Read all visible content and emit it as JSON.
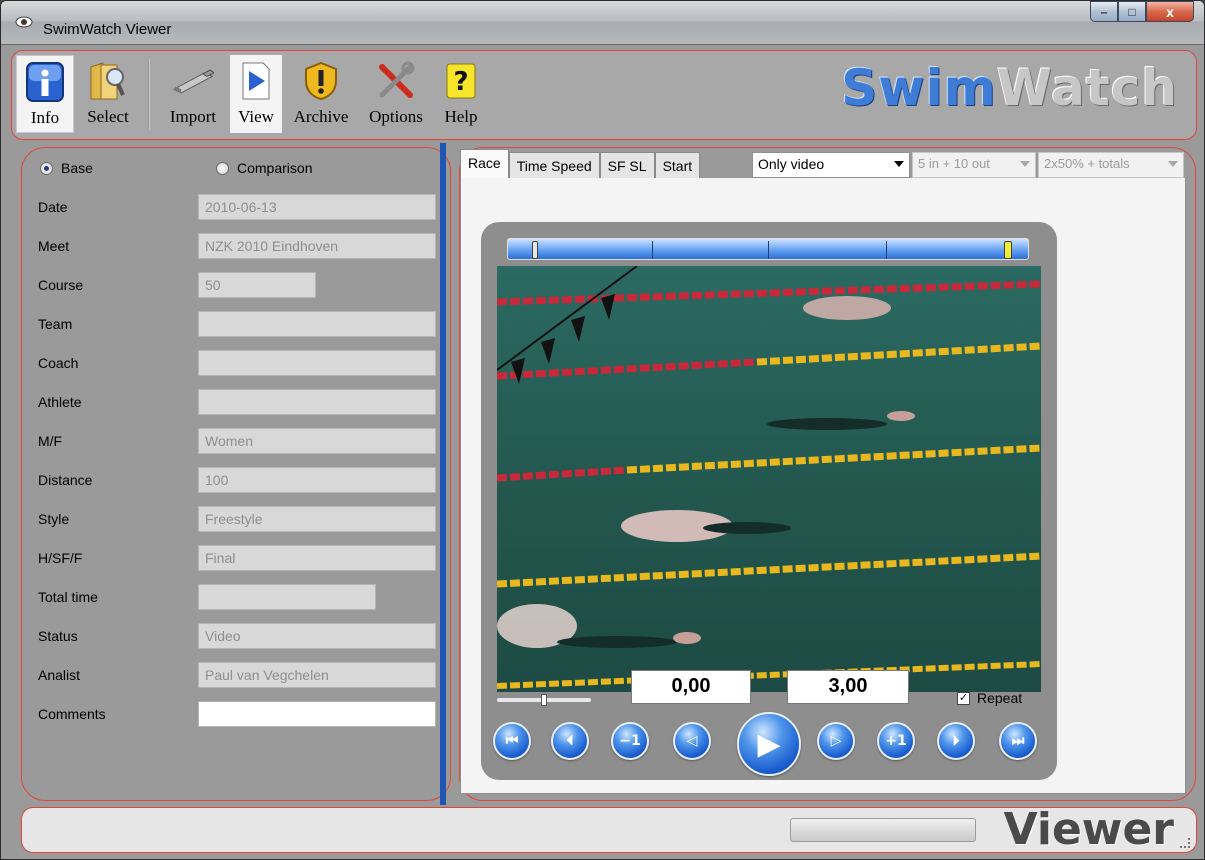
{
  "window": {
    "title": "SwimWatch Viewer",
    "min": "–",
    "max": "□",
    "close": "x"
  },
  "toolbar": {
    "items": [
      {
        "label": "Info"
      },
      {
        "label": "Select"
      },
      {
        "label": "Import"
      },
      {
        "label": "View"
      },
      {
        "label": "Archive"
      },
      {
        "label": "Options"
      },
      {
        "label": "Help"
      }
    ],
    "active": "Info",
    "logo_part1": "Swim",
    "logo_part2": "Watch"
  },
  "left": {
    "radio_base": "Base",
    "radio_comparison": "Comparison",
    "selected_radio": "Base",
    "fields": [
      {
        "label": "Date",
        "value": "2010-06-13"
      },
      {
        "label": "Meet",
        "value": "NZK 2010 Eindhoven"
      },
      {
        "label": "Course",
        "value": "50"
      },
      {
        "label": "Team",
        "value": ""
      },
      {
        "label": "Coach",
        "value": ""
      },
      {
        "label": "Athlete",
        "value": ""
      },
      {
        "label": "M/F",
        "value": "Women"
      },
      {
        "label": "Distance",
        "value": "100"
      },
      {
        "label": "Style",
        "value": "Freestyle"
      },
      {
        "label": "H/SF/F",
        "value": "Final"
      },
      {
        "label": "Total time",
        "value": ""
      },
      {
        "label": "Status",
        "value": "Video"
      },
      {
        "label": "Analist",
        "value": "Paul van Vegchelen"
      },
      {
        "label": "Comments",
        "value": ""
      }
    ]
  },
  "right": {
    "tabs": [
      {
        "label": "Race"
      },
      {
        "label": "Time Speed"
      },
      {
        "label": "SF SL"
      },
      {
        "label": "Start"
      }
    ],
    "active_tab": "Race",
    "combo_mode": "Only video",
    "combo_interval": "5 in + 10 out",
    "combo_layout": "2x50% + totals"
  },
  "player": {
    "time_start": "0,00",
    "time_end": "3,00",
    "repeat_label": "Repeat",
    "repeat_checked": true,
    "controls": [
      "skip-to-start",
      "step-back",
      "minus-one",
      "frame-back",
      "play",
      "frame-forward",
      "plus-one",
      "step-forward",
      "skip-to-end"
    ],
    "control_glyphs": [
      "⏮",
      "⏴",
      "−1",
      "◁",
      "▶",
      "▷",
      "+1",
      "⏵",
      "⏭"
    ]
  },
  "statusbar": {
    "logo": "Viewer"
  },
  "colors": {
    "accent_red": "#e0463b",
    "splitter_blue": "#1f56b3",
    "swim_blue": "#3f7cd6"
  }
}
